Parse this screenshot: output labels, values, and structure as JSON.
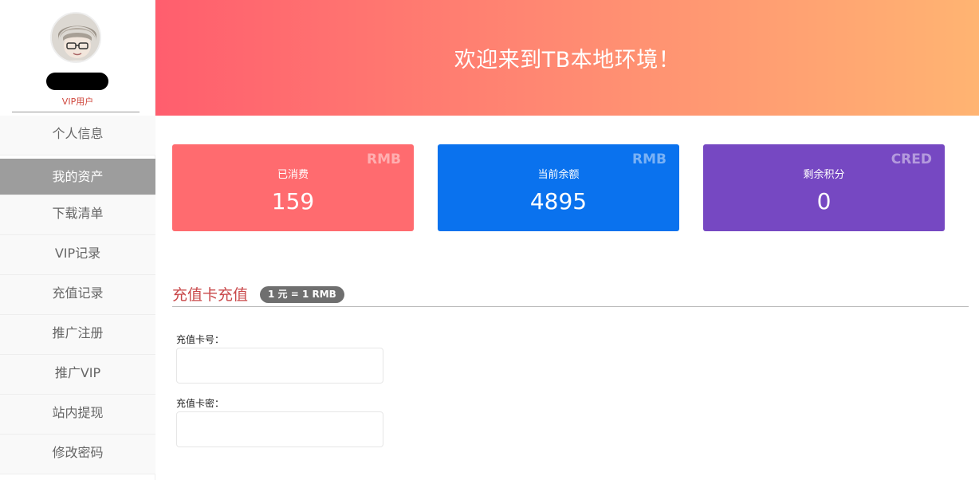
{
  "profile": {
    "avatar_icon": "user-avatar-icon",
    "vip_label": "VIP用户"
  },
  "menu": {
    "items": [
      {
        "label": "个人信息",
        "active": false
      },
      {
        "label": "我的资产",
        "active": true
      },
      {
        "label": "下载清单",
        "active": false
      },
      {
        "label": "VIP记录",
        "active": false
      },
      {
        "label": "充值记录",
        "active": false
      },
      {
        "label": "推广注册",
        "active": false
      },
      {
        "label": "推广VIP",
        "active": false
      },
      {
        "label": "站内提现",
        "active": false
      },
      {
        "label": "修改密码",
        "active": false
      }
    ]
  },
  "banner": {
    "title": "欢迎来到TB本地环境！"
  },
  "stats": {
    "spent": {
      "label": "已消费",
      "unit": "RMB",
      "value": "159",
      "color": "#ff6b6f"
    },
    "balance": {
      "label": "当前余额",
      "unit": "RMB",
      "value": "4895",
      "color": "#0a72ee"
    },
    "credits": {
      "label": "剩余积分",
      "unit": "CRED",
      "value": "0",
      "color": "#7648c2"
    }
  },
  "recharge": {
    "title": "充值卡充值",
    "rate": "1 元 = 1 RMB",
    "card_number_label": "充值卡号：",
    "card_password_label": "充值卡密：",
    "card_number_value": "",
    "card_password_value": ""
  }
}
